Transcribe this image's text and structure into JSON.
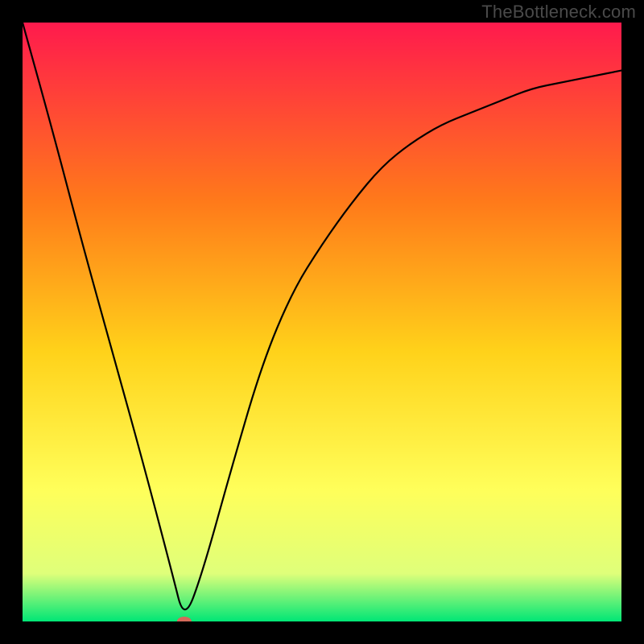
{
  "watermark": "TheBottleneck.com",
  "chart_data": {
    "type": "line",
    "title": "",
    "xlabel": "",
    "ylabel": "",
    "xlim": [
      0,
      100
    ],
    "ylim": [
      0,
      100
    ],
    "grid": false,
    "background_gradient": {
      "top": "#ff1a4d",
      "mid1": "#ff7a1a",
      "mid2": "#ffd21a",
      "mid3": "#ffff5a",
      "mid4": "#dfff7a",
      "bottom": "#00e676"
    },
    "series": [
      {
        "name": "bottleneck-curve",
        "x": [
          0,
          5,
          10,
          15,
          20,
          25,
          27,
          30,
          35,
          40,
          45,
          50,
          55,
          60,
          65,
          70,
          75,
          80,
          85,
          90,
          95,
          100
        ],
        "values": [
          100,
          82,
          63,
          45,
          27,
          8,
          0,
          8,
          26,
          43,
          55,
          63,
          70,
          76,
          80,
          83,
          85,
          87,
          89,
          90,
          91,
          92
        ]
      }
    ],
    "marker": {
      "x": 27,
      "y": 0,
      "color": "#d46a5a",
      "rx": 9,
      "ry": 6
    }
  }
}
